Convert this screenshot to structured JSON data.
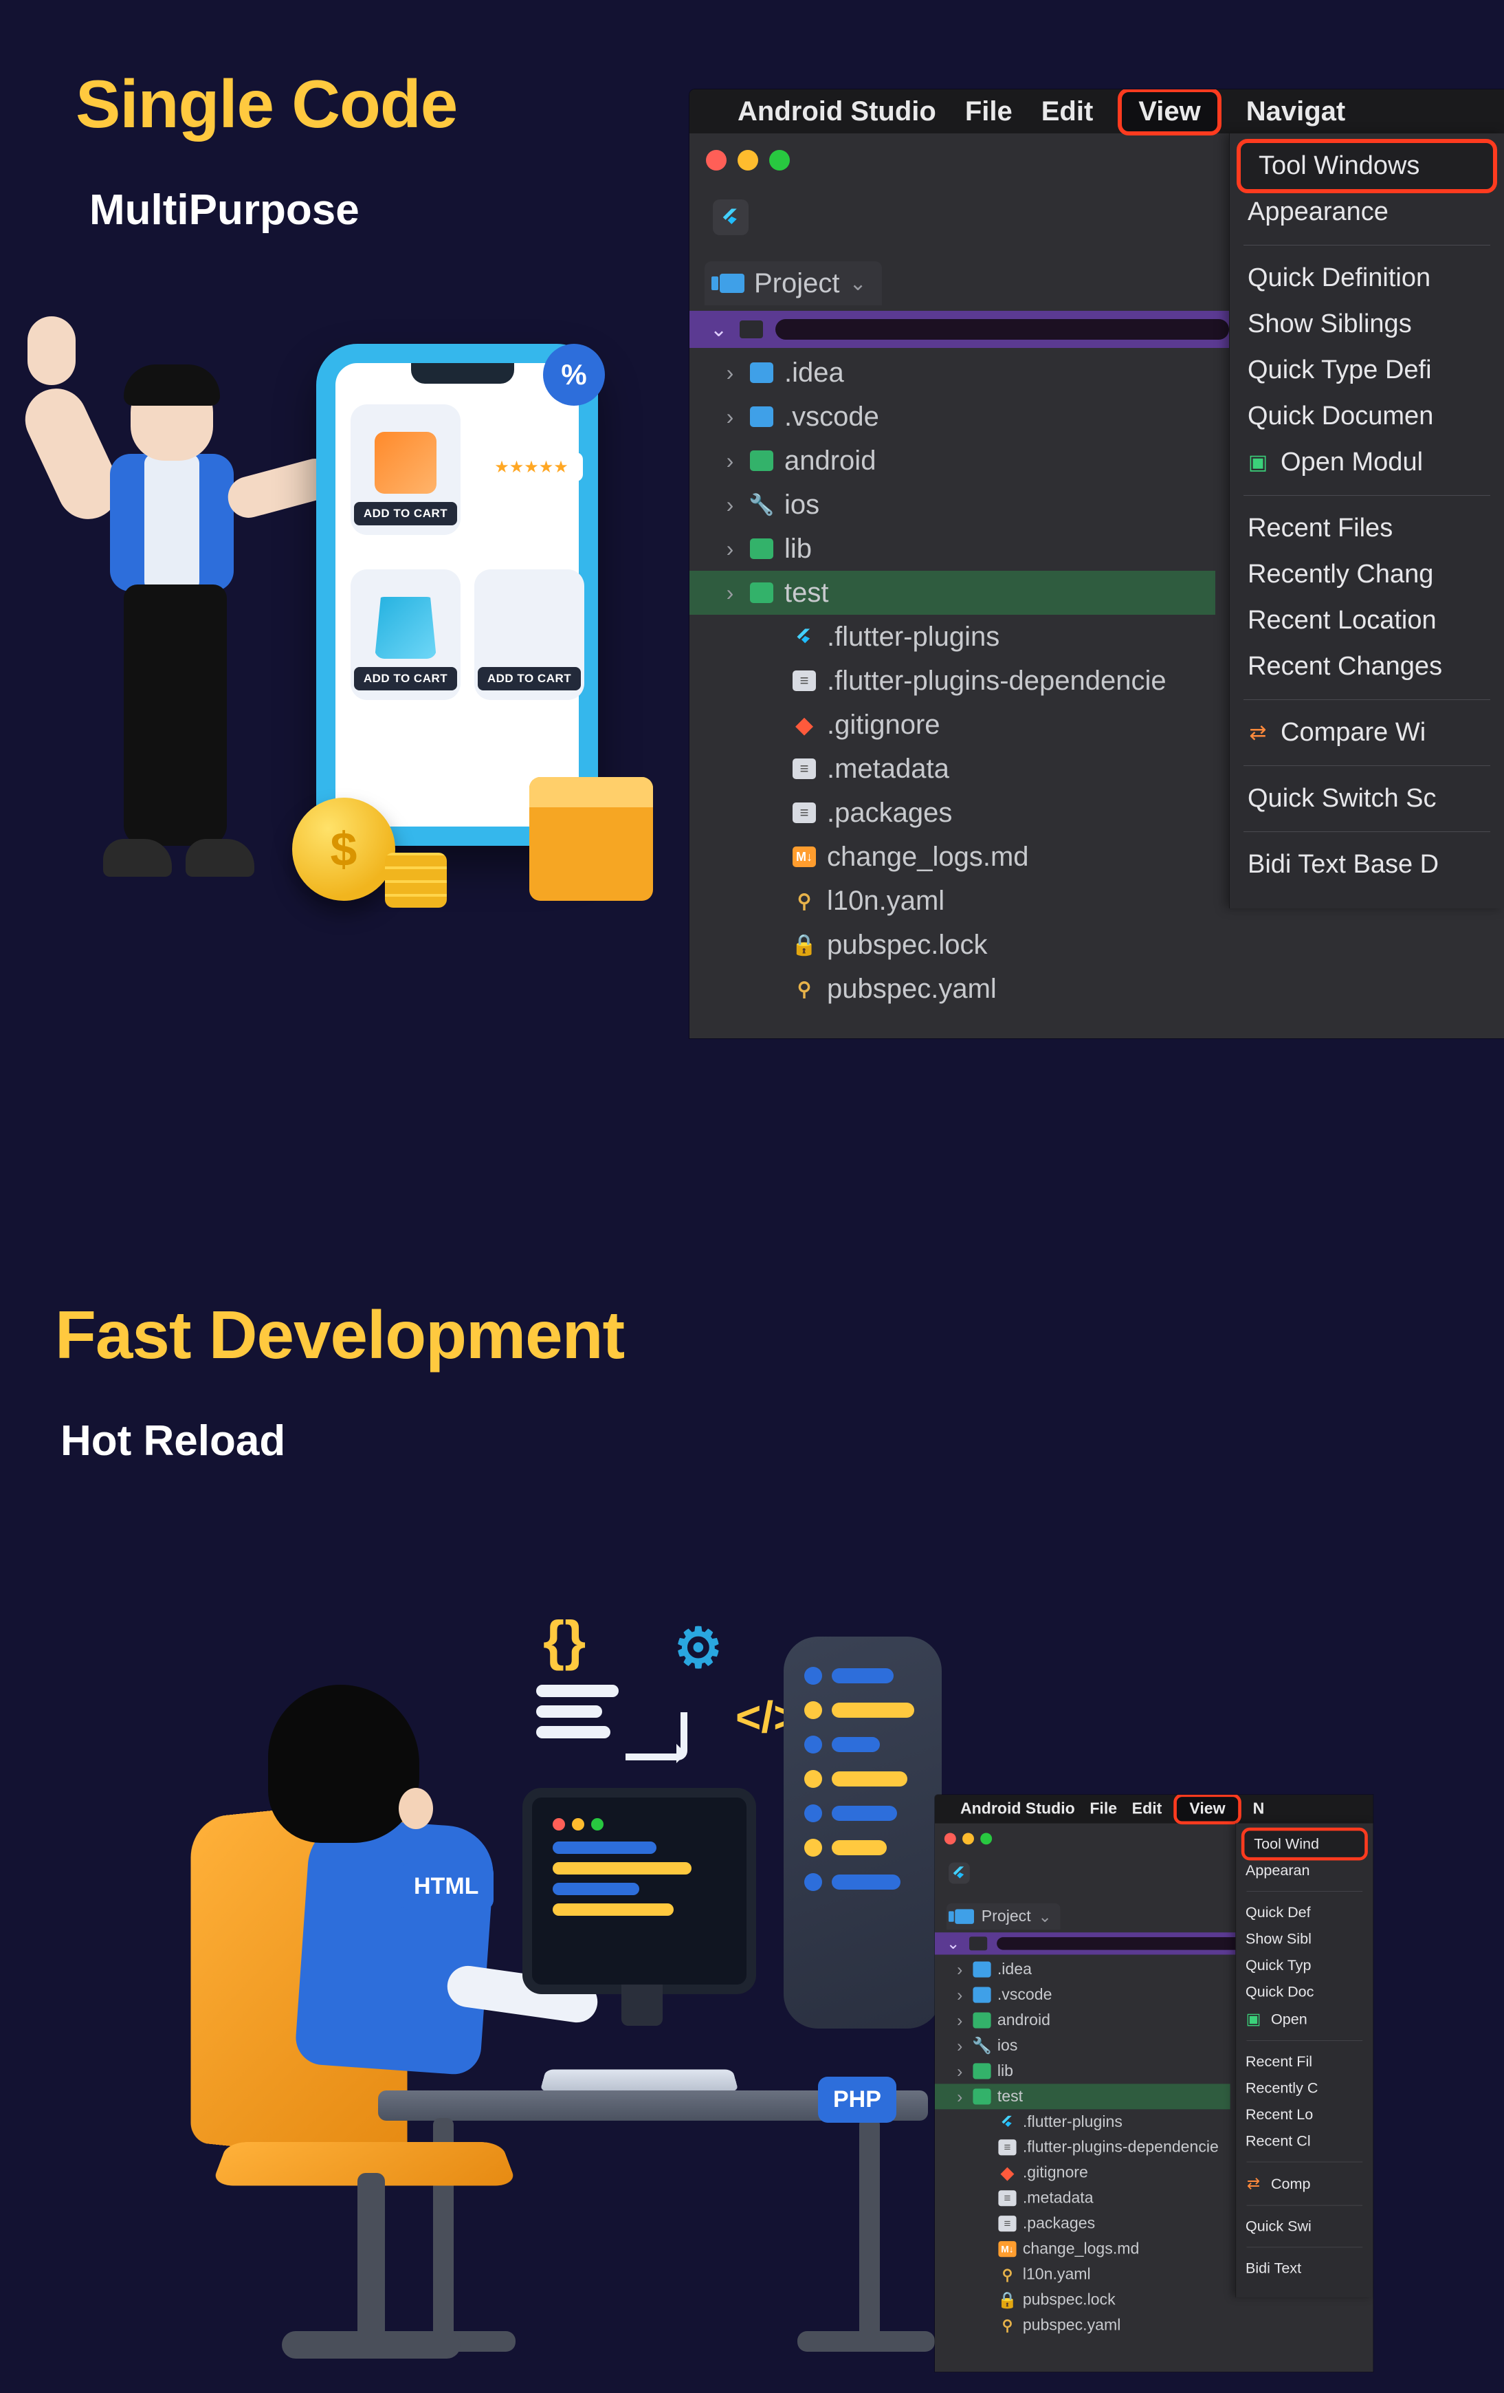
{
  "headings": {
    "title1": "Single Code",
    "sub1": "MultiPurpose",
    "title2": "Fast Development",
    "sub2": "Hot Reload"
  },
  "shopping": {
    "discount_symbol": "%",
    "coin_symbol": "$",
    "add_to_cart": "ADD TO CART",
    "stars": "★★★★★"
  },
  "dev": {
    "tag_html": "HTML",
    "tag_php": "PHP",
    "braces": "{}",
    "gear": "⚙",
    "code": "</>"
  },
  "ide": {
    "app_name": "Android Studio",
    "menu": {
      "file": "File",
      "edit": "Edit",
      "view": "View",
      "navigate": "Navigat"
    },
    "project_tab": "Project",
    "tree": [
      {
        "kind": "dir",
        "icon": "folder",
        "name": ".idea"
      },
      {
        "kind": "dir",
        "icon": "folder",
        "name": ".vscode"
      },
      {
        "kind": "dir",
        "icon": "folder-g",
        "name": "android"
      },
      {
        "kind": "dir",
        "icon": "wrench",
        "name": "ios"
      },
      {
        "kind": "dir",
        "icon": "folder-g",
        "name": "lib"
      },
      {
        "kind": "dir",
        "icon": "folder-g",
        "name": "test",
        "selected": true
      },
      {
        "kind": "file",
        "icon": "flutter",
        "name": ".flutter-plugins"
      },
      {
        "kind": "file",
        "icon": "doc",
        "name": ".flutter-plugins-dependencie"
      },
      {
        "kind": "file",
        "icon": "git",
        "name": ".gitignore"
      },
      {
        "kind": "file",
        "icon": "doc",
        "name": ".metadata"
      },
      {
        "kind": "file",
        "icon": "doc",
        "name": ".packages"
      },
      {
        "kind": "file",
        "icon": "md",
        "name": "change_logs.md"
      },
      {
        "kind": "file",
        "icon": "yaml",
        "name": "l10n.yaml"
      },
      {
        "kind": "file",
        "icon": "lock",
        "name": "pubspec.lock"
      },
      {
        "kind": "file",
        "icon": "yaml",
        "name": "pubspec.yaml"
      }
    ],
    "view_menu_1": [
      {
        "t": "Tool Windows",
        "hl": true
      },
      {
        "t": "Appearance"
      },
      {
        "sep": true
      },
      {
        "t": "Quick Definition"
      },
      {
        "t": "Show Siblings"
      },
      {
        "t": "Quick Type Defi"
      },
      {
        "t": "Quick Documen"
      },
      {
        "t": "Open Modul",
        "ic": "green"
      },
      {
        "sep": true
      },
      {
        "t": "Recent Files"
      },
      {
        "t": "Recently Chang"
      },
      {
        "t": "Recent Location"
      },
      {
        "t": "Recent Changes"
      },
      {
        "sep": true
      },
      {
        "t": "Compare Wi",
        "ic": "orange"
      },
      {
        "sep": true
      },
      {
        "t": "Quick Switch Sc"
      },
      {
        "sep": true
      },
      {
        "t": "Bidi Text Base D"
      }
    ],
    "view_menu_2": [
      {
        "t": "Tool Wind",
        "hl": true
      },
      {
        "t": "Appearan"
      },
      {
        "sep": true
      },
      {
        "t": "Quick Def"
      },
      {
        "t": "Show Sibl"
      },
      {
        "t": "Quick Typ"
      },
      {
        "t": "Quick Doc"
      },
      {
        "t": "Open",
        "ic": "green"
      },
      {
        "sep": true
      },
      {
        "t": "Recent Fil"
      },
      {
        "t": "Recently C"
      },
      {
        "t": "Recent Lo"
      },
      {
        "t": "Recent Cl"
      },
      {
        "sep": true
      },
      {
        "t": "Comp",
        "ic": "orange"
      },
      {
        "sep": true
      },
      {
        "t": "Quick Swi"
      },
      {
        "sep": true
      },
      {
        "t": "Bidi Text"
      }
    ],
    "menu2_navigate": "N"
  }
}
